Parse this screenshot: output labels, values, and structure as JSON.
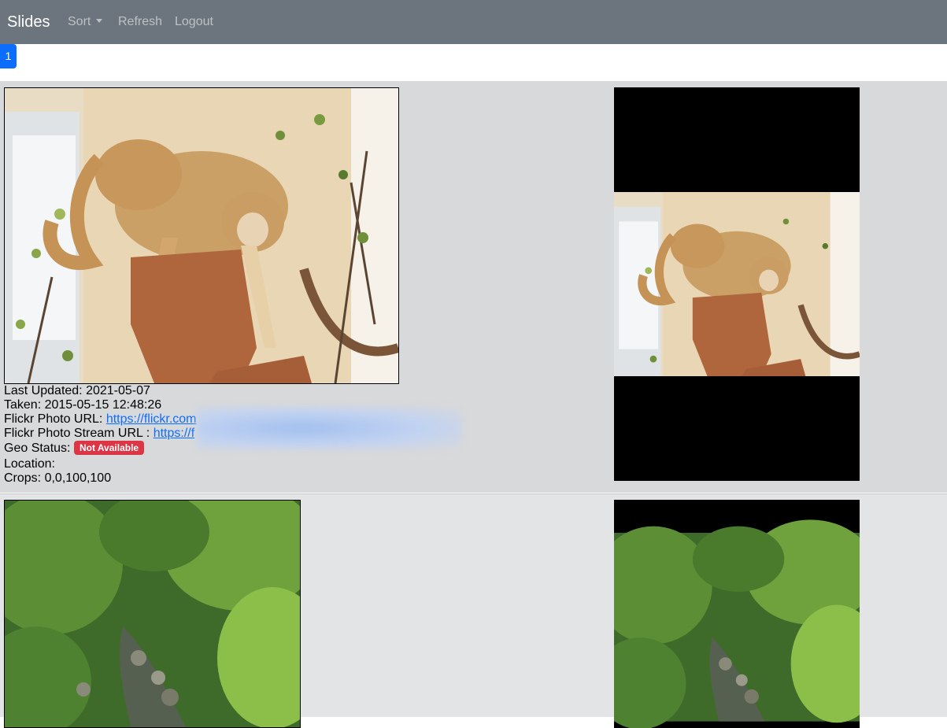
{
  "navbar": {
    "brand": "Slides",
    "sort_label": "Sort",
    "refresh_label": "Refresh",
    "logout_label": "Logout"
  },
  "pagination": {
    "current_page": "1"
  },
  "slides": [
    {
      "last_updated_label": "Last Updated: ",
      "last_updated": "2021-05-07",
      "taken_label": "Taken: ",
      "taken": "2015-05-15 12:48:26",
      "flickr_photo_url_label": "Flickr Photo URL: ",
      "flickr_photo_url": "https://flickr.com",
      "flickr_stream_url_label": "Flickr Photo Stream URL : ",
      "flickr_stream_url": "https://f",
      "geo_status_label": "Geo Status:",
      "geo_status": "Not Available",
      "location_label": "Location:",
      "location": "",
      "crops_label": "Crops: ",
      "crops": "0,0,100,100"
    }
  ],
  "colors": {
    "navbar": "#6c757d",
    "accent": "#0d6efd",
    "badge_danger": "#dc3545",
    "row_bg_1": "#d8d9db",
    "row_bg_2": "#e3e4e6"
  }
}
